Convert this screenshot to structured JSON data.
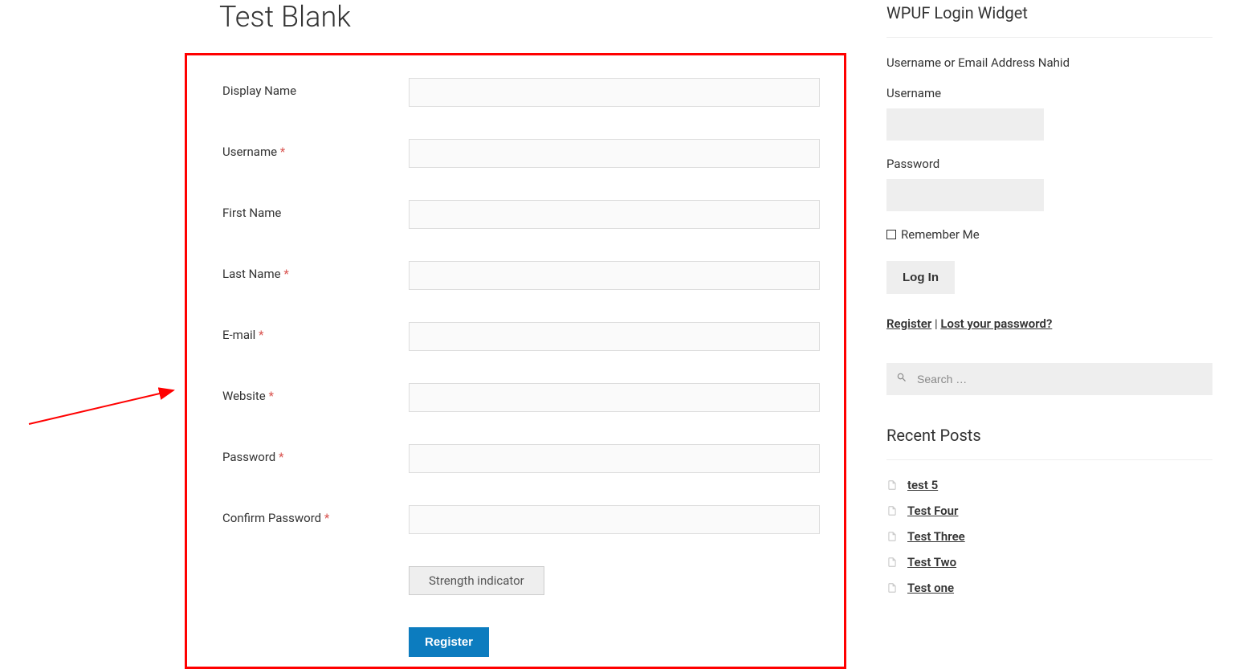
{
  "page": {
    "title": "Test Blank"
  },
  "form": {
    "fields": [
      {
        "label": "Display Name",
        "required": false
      },
      {
        "label": "Username",
        "required": true
      },
      {
        "label": "First Name",
        "required": false
      },
      {
        "label": "Last Name",
        "required": true
      },
      {
        "label": "E-mail",
        "required": true
      },
      {
        "label": "Website",
        "required": true
      },
      {
        "label": "Password",
        "required": true
      },
      {
        "label": "Confirm Password",
        "required": true
      }
    ],
    "strength_indicator": "Strength indicator",
    "register_button": "Register",
    "required_marker": "*"
  },
  "sidebar": {
    "login_widget": {
      "title": "WPUF Login Widget",
      "intro_text": "Username or Email Address Nahid",
      "username_label": "Username",
      "password_label": "Password",
      "remember_label": "Remember Me",
      "login_button": "Log In",
      "register_link": "Register",
      "separator": " | ",
      "lost_password_link": "Lost your password?"
    },
    "search": {
      "placeholder": "Search …"
    },
    "recent_posts": {
      "title": "Recent Posts",
      "items": [
        {
          "title": "test 5"
        },
        {
          "title": "Test Four"
        },
        {
          "title": "Test Three"
        },
        {
          "title": "Test Two"
        },
        {
          "title": "Test one"
        }
      ]
    }
  }
}
